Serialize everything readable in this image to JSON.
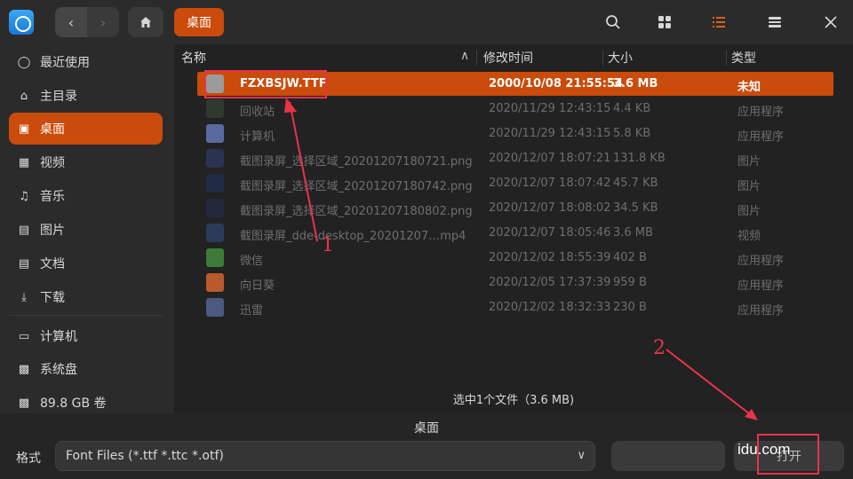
{
  "toolbar": {
    "breadcrumb": "桌面"
  },
  "sidebar": {
    "items": [
      {
        "label": "最近使用",
        "icon": "clock-icon"
      },
      {
        "label": "主目录",
        "icon": "home-icon"
      },
      {
        "label": "桌面",
        "icon": "desktop-icon"
      },
      {
        "label": "视频",
        "icon": "video-icon"
      },
      {
        "label": "音乐",
        "icon": "music-icon"
      },
      {
        "label": "图片",
        "icon": "picture-icon"
      },
      {
        "label": "文档",
        "icon": "document-icon"
      },
      {
        "label": "下载",
        "icon": "download-icon"
      },
      {
        "label": "计算机",
        "icon": "computer-icon"
      },
      {
        "label": "系统盘",
        "icon": "disk-icon"
      },
      {
        "label": "89.8 GB 卷",
        "icon": "volume-icon"
      }
    ]
  },
  "table": {
    "headers": {
      "name": "名称",
      "modified": "修改时间",
      "size": "大小",
      "type": "类型"
    },
    "rows": [
      {
        "name": "FZXBSJW.TTF",
        "modified": "2000/10/08 21:55:54",
        "size": "3.6 MB",
        "type": "未知",
        "icon": "font-file-icon",
        "color": "#9b9b9b"
      },
      {
        "name": "回收站",
        "modified": "2020/11/29 12:43:15",
        "size": "4.4 KB",
        "type": "应用程序",
        "icon": "trash-icon",
        "color": "#2f3a2f"
      },
      {
        "name": "计算机",
        "modified": "2020/11/29 12:43:15",
        "size": "5.8 KB",
        "type": "应用程序",
        "icon": "computer-icon",
        "color": "#5a6aa0"
      },
      {
        "name": "截图录屏_选择区域_20201207180721.png",
        "modified": "2020/12/07 18:07:21",
        "size": "131.8 KB",
        "type": "图片",
        "icon": "image-thumb-icon",
        "color": "#2a3350"
      },
      {
        "name": "截图录屏_选择区域_20201207180742.png",
        "modified": "2020/12/07 18:07:42",
        "size": "45.7 KB",
        "type": "图片",
        "icon": "image-thumb-icon",
        "color": "#1f2a44"
      },
      {
        "name": "截图录屏_选择区域_20201207180802.png",
        "modified": "2020/12/07 18:08:02",
        "size": "34.5 KB",
        "type": "图片",
        "icon": "image-thumb-icon",
        "color": "#23283a"
      },
      {
        "name": "截图录屏_dde-desktop_20201207…mp4",
        "modified": "2020/12/07 18:05:46",
        "size": "3.6 MB",
        "type": "视频",
        "icon": "video-thumb-icon",
        "color": "#2c3a5a"
      },
      {
        "name": "微信",
        "modified": "2020/12/02 18:55:39",
        "size": "402 B",
        "type": "应用程序",
        "icon": "wechat-icon",
        "color": "#3d7a37"
      },
      {
        "name": "向日葵",
        "modified": "2020/12/05 17:37:39",
        "size": "959 B",
        "type": "应用程序",
        "icon": "sunflower-icon",
        "color": "#b85a2a"
      },
      {
        "name": "迅雷",
        "modified": "2020/12/02 18:32:33",
        "size": "230 B",
        "type": "应用程序",
        "icon": "thunder-icon",
        "color": "#4a5a80"
      }
    ]
  },
  "status": "选中1个文件（3.6 MB)",
  "bottom": {
    "location": "桌面",
    "format_label": "格式",
    "format_value": "Font Files (*.ttf *.ttc *.otf)",
    "cancel_label": "",
    "open_label": "打开"
  },
  "annotations": {
    "label_1": "1",
    "label_2": "2",
    "watermark": "idu.com"
  },
  "colors": {
    "accent": "#ca4b0b",
    "annotation": "#e8334a"
  }
}
